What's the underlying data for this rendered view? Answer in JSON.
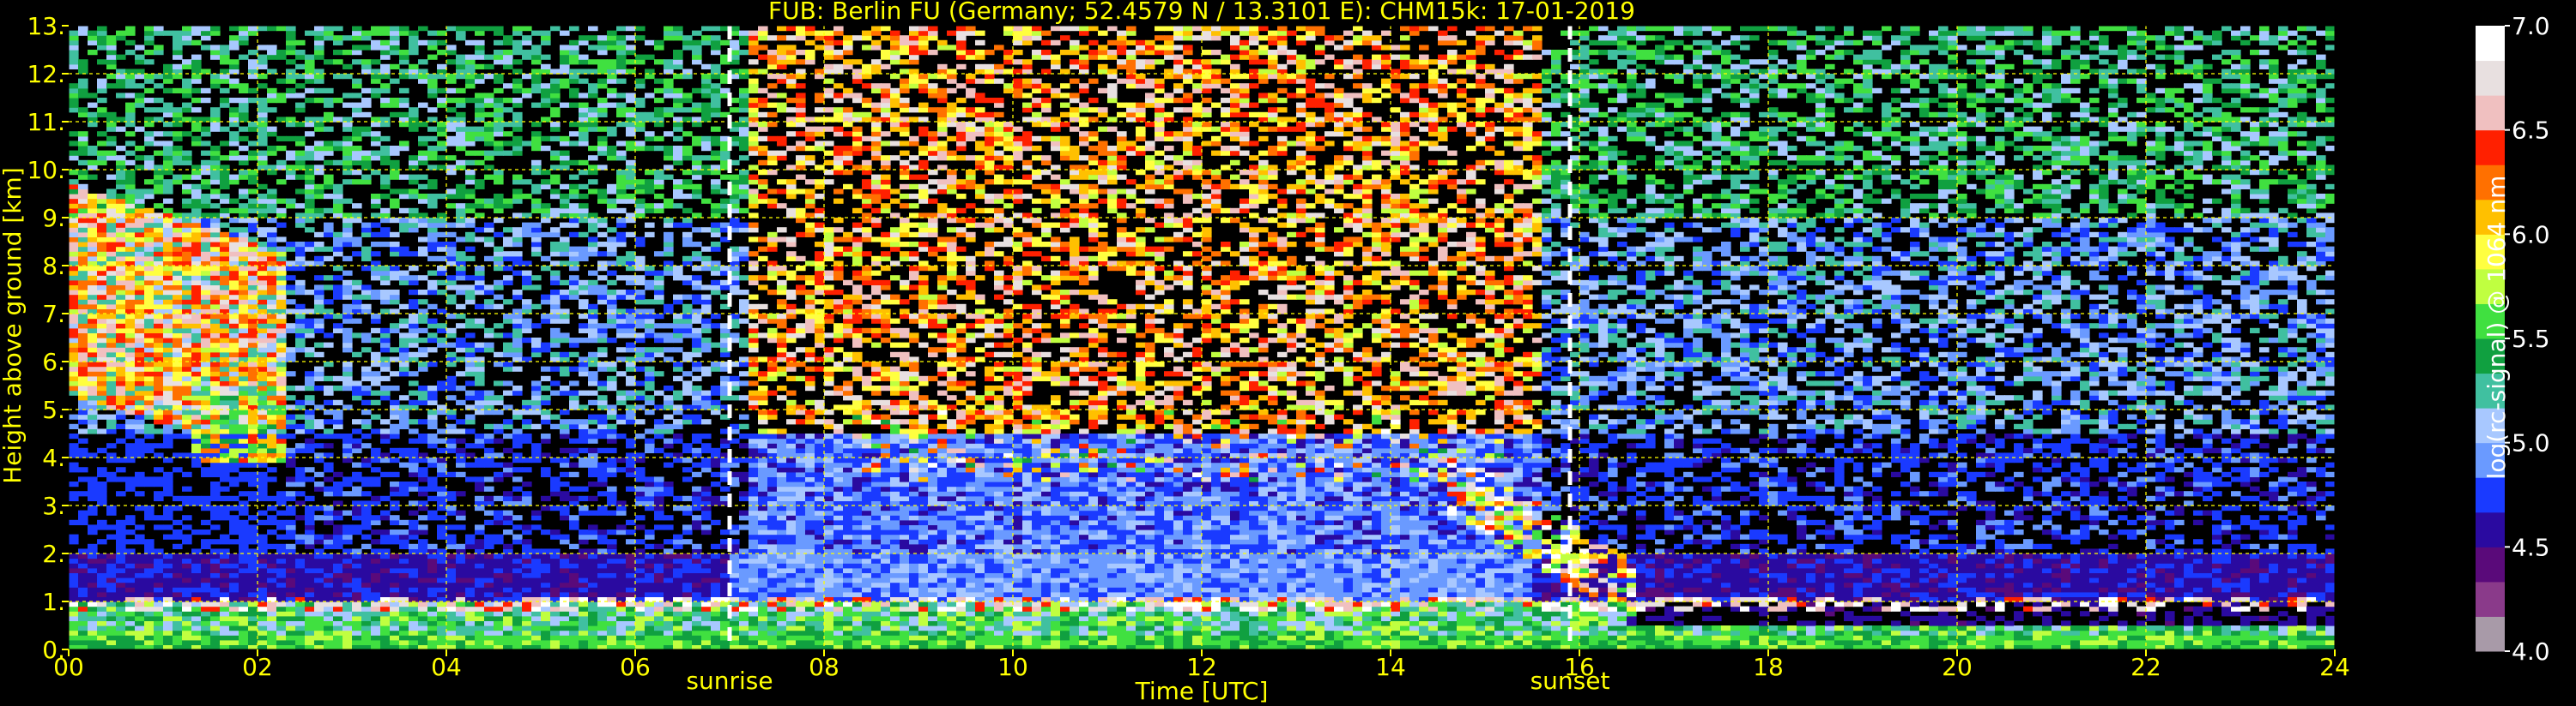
{
  "chart_data": {
    "type": "heatmap",
    "title": "FUB: Berlin FU (Germany; 52.4579 N / 13.3101 E):    CHM15k: 17-01-2019",
    "xlabel": "Time [UTC]",
    "ylabel": "Height above ground [km]",
    "xlim": [
      0,
      24
    ],
    "ylim": [
      0,
      13
    ],
    "x_ticks": [
      0,
      2,
      4,
      6,
      8,
      10,
      12,
      14,
      16,
      18,
      20,
      22,
      24
    ],
    "x_tick_labels": [
      "00",
      "02",
      "04",
      "06",
      "08",
      "10",
      "12",
      "14",
      "16",
      "18",
      "20",
      "22",
      "24"
    ],
    "y_ticks": [
      0,
      1,
      2,
      3,
      4,
      5,
      6,
      7,
      8,
      9,
      10,
      11,
      12,
      13
    ],
    "y_tick_labels": [
      "0.",
      "1.",
      "2.",
      "3.",
      "4.",
      "5.",
      "6.",
      "7.",
      "8.",
      "9.",
      "10.",
      "11.",
      "12.",
      "13."
    ],
    "grid": true,
    "grid_color": "#ffff00",
    "annotations": [
      {
        "label": "sunrise",
        "x": 7.0
      },
      {
        "label": "sunset",
        "x": 15.9
      }
    ],
    "colorbar": {
      "label": "log(rc-signal) @ 1064 nm",
      "range": [
        4.0,
        7.0
      ],
      "ticks": [
        4.0,
        4.5,
        5.0,
        5.5,
        6.0,
        6.5,
        7.0
      ],
      "tick_labels": [
        "4.0",
        "4.5",
        "5.0",
        "5.5",
        "6.0",
        "6.5",
        "7.0"
      ]
    },
    "features": [
      {
        "name": "boundary-layer",
        "x_range": [
          0,
          24
        ],
        "height_km": [
          0.0,
          1.0
        ]
      },
      {
        "name": "night-cirrus",
        "x_range": [
          0,
          2.3
        ],
        "height_km": [
          4.2,
          10.5
        ]
      },
      {
        "name": "mid-clouds",
        "x_range": [
          8.3,
          15.2
        ],
        "height_km": [
          3.5,
          5.0
        ]
      },
      {
        "name": "sinking-cloud",
        "x_range": [
          15.2,
          16.6
        ],
        "height_km": [
          1.5,
          4.0
        ]
      }
    ]
  },
  "colors": {
    "background": "#000000",
    "text": "#ffff00",
    "colorbar_text": "#ffffff",
    "colormap": [
      "#a89aa8",
      "#8a3a8a",
      "#5a0a7a",
      "#2a0aa0",
      "#1a3aff",
      "#6a9aff",
      "#a8c8ff",
      "#40c0a0",
      "#10a040",
      "#40e040",
      "#c0ff40",
      "#ffff40",
      "#ffc000",
      "#ff7000",
      "#ff2000",
      "#f0c0c0",
      "#e8e0e0",
      "#ffffff"
    ]
  }
}
